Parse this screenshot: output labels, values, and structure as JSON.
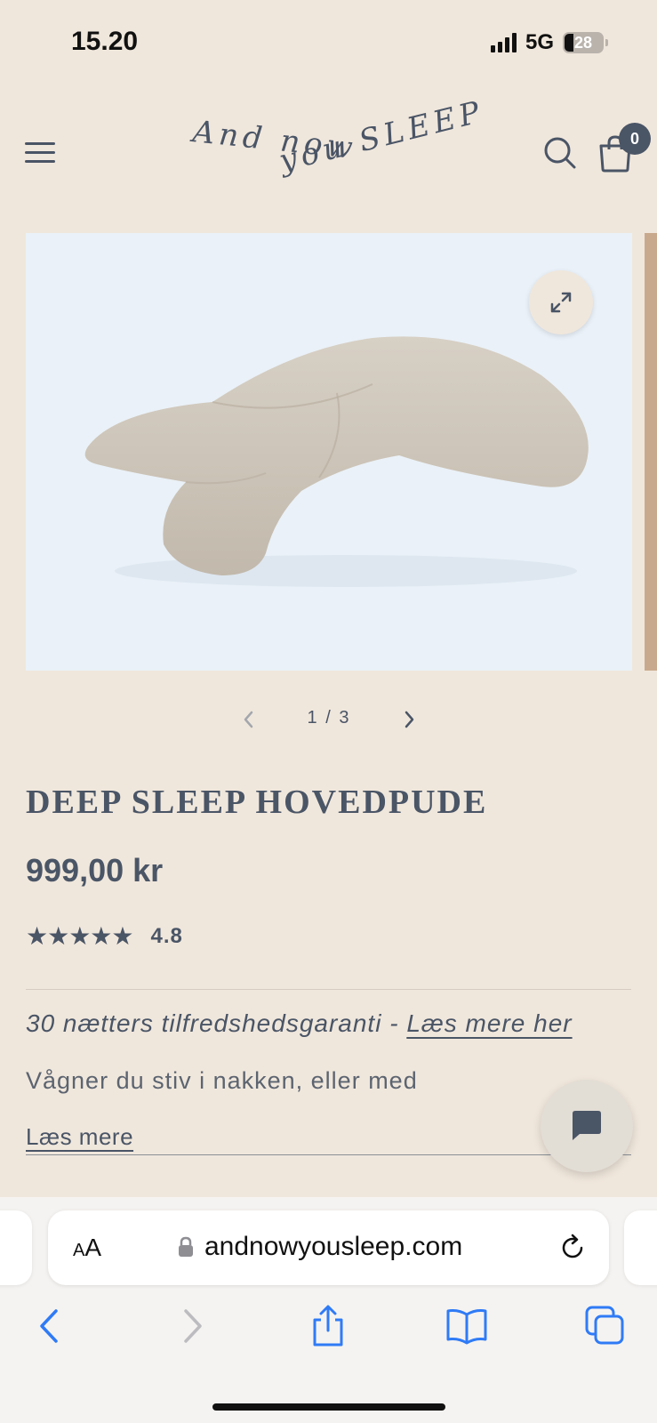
{
  "status_bar": {
    "time": "15.20",
    "network": "5G",
    "battery": "28"
  },
  "header": {
    "logo_line1": "And now",
    "logo_line2": "you SLEEP",
    "cart_count": "0",
    "icons": [
      "menu-icon",
      "search-icon",
      "cart-icon"
    ]
  },
  "gallery": {
    "current": 1,
    "total": 3,
    "counter": "1 / 3",
    "expand_icon": "expand-icon"
  },
  "product": {
    "title": "DEEP SLEEP HOVEDPUDE",
    "price": "999,00 kr",
    "stars": "★★★★★",
    "rating": "4.8",
    "guarantee_text": "30 nætters tilfredshedsgaranti - ",
    "guarantee_link": "Læs mere her",
    "description": "Vågner du stiv i nakken, eller med",
    "read_more": "Læs mere"
  },
  "browser": {
    "aa_label_small": "A",
    "aa_label_large": "A",
    "url": "andnowyousleep.com"
  },
  "colors": {
    "background": "#f0e7dc",
    "text": "#4a5566",
    "accent_link": "#2f7bf6"
  }
}
